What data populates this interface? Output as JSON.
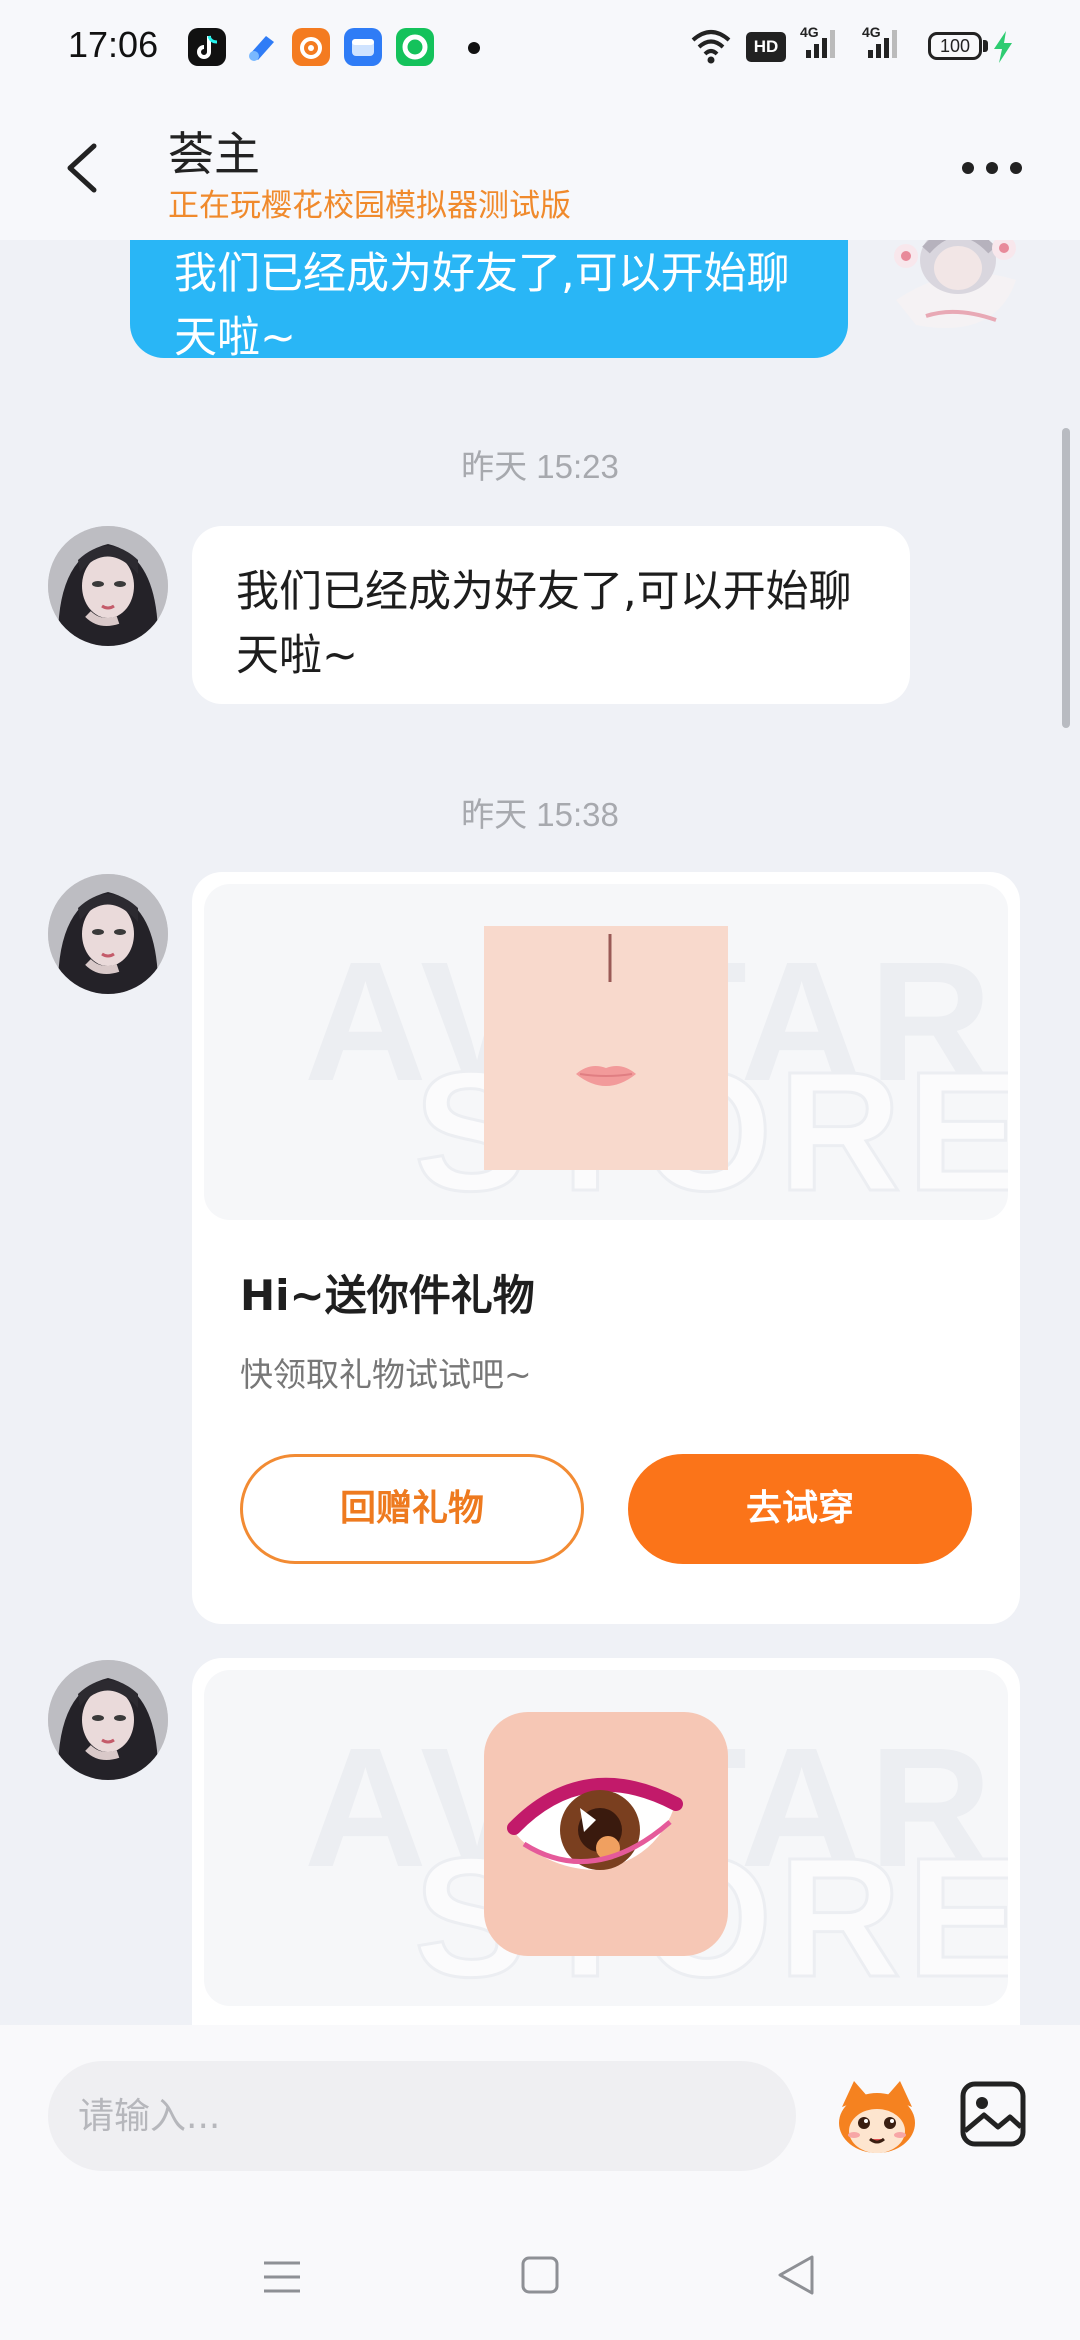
{
  "status_bar": {
    "time": "17:06",
    "network_badge": "HD",
    "sim1": "4G",
    "sim2": "4G",
    "battery": "100"
  },
  "header": {
    "name": "荟主",
    "subtitle": "正在玩樱花校园模拟器测试版"
  },
  "messages": {
    "outgoing_text": "我们已经成为好友了,可以开始聊天啦~",
    "ts1": "昨天 15:23",
    "incoming_text": "我们已经成为好友了,可以开始聊天啦~",
    "ts2": "昨天 15:38"
  },
  "gift_card": {
    "watermark_line1": "AVATAR",
    "watermark_line2": "STORE",
    "title": "Hi~送你件礼物",
    "desc": "快领取礼物试试吧~",
    "return_label": "回赠礼物",
    "try_label": "去试穿"
  },
  "input": {
    "placeholder": "请输入..."
  },
  "colors": {
    "accent_orange": "#fb7419",
    "outgoing_bubble": "#29b6f6",
    "background": "#eff1f6"
  }
}
